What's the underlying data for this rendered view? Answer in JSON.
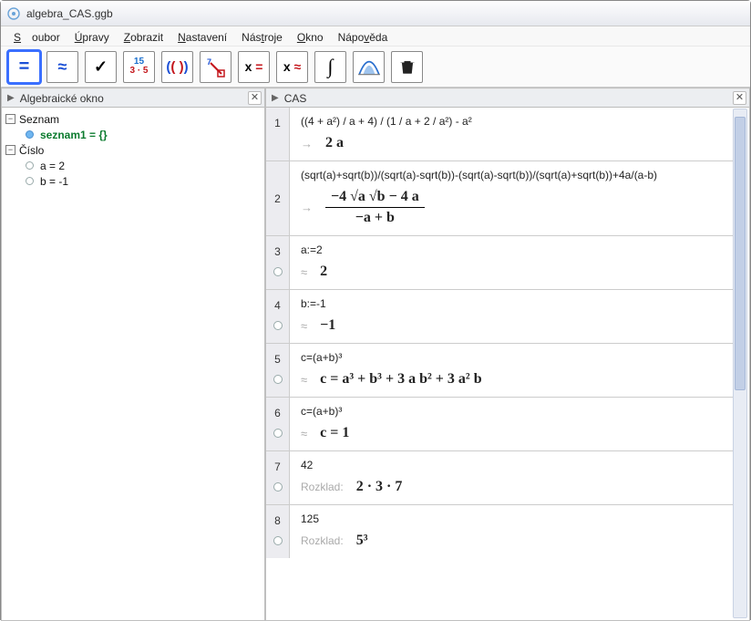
{
  "titlebar": {
    "text": "algebra_CAS.ggb"
  },
  "menu": {
    "soubor": "Soubor",
    "upravy": "Úpravy",
    "zobrazit": "Zobrazit",
    "nastaveni": "Nastavení",
    "nastroje": "Nástroje",
    "okno": "Okno",
    "napoveda": "Nápověda"
  },
  "toolbar": {
    "exact_top": "15",
    "exact_bot": "3 · 5"
  },
  "left": {
    "title": "Algebraické okno",
    "seznam_label": "Seznam",
    "seznam1_name": "seznam1",
    "seznam1_eq": " = {}",
    "cislo_label": "Číslo",
    "a_line": "a = 2",
    "b_line": "b = -1"
  },
  "right": {
    "title": "CAS",
    "rows": [
      {
        "n": "1",
        "input": "((4 + a²) / a + 4) / (1 / a + 2 / a²) - a²",
        "sym": "→",
        "out": "2 a"
      },
      {
        "n": "2",
        "input": "(sqrt(a)+sqrt(b))/(sqrt(a)-sqrt(b))-(sqrt(a)-sqrt(b))/(sqrt(a)+sqrt(b))+4a/(a-b)",
        "sym": "→",
        "frac_num": "−4 √a √b − 4 a",
        "frac_den": "−a + b"
      },
      {
        "n": "3",
        "input": "a:=2",
        "sym": "≈",
        "out": "2",
        "bullet": true
      },
      {
        "n": "4",
        "input": "b:=-1",
        "sym": "≈",
        "out": "−1",
        "bullet": true
      },
      {
        "n": "5",
        "input": "c=(a+b)³",
        "sym": "≈",
        "out": "c = a³ + b³ + 3 a b² + 3 a² b",
        "bullet": true
      },
      {
        "n": "6",
        "input": "c=(a+b)³",
        "sym": "≈",
        "out": "c = 1",
        "bullet": true
      },
      {
        "n": "7",
        "input": "42",
        "label": "Rozklad:",
        "out": "2 · 3 · 7",
        "bullet": true
      },
      {
        "n": "8",
        "input": "125",
        "label": "Rozklad:",
        "out": "5³",
        "bullet": true
      }
    ]
  }
}
